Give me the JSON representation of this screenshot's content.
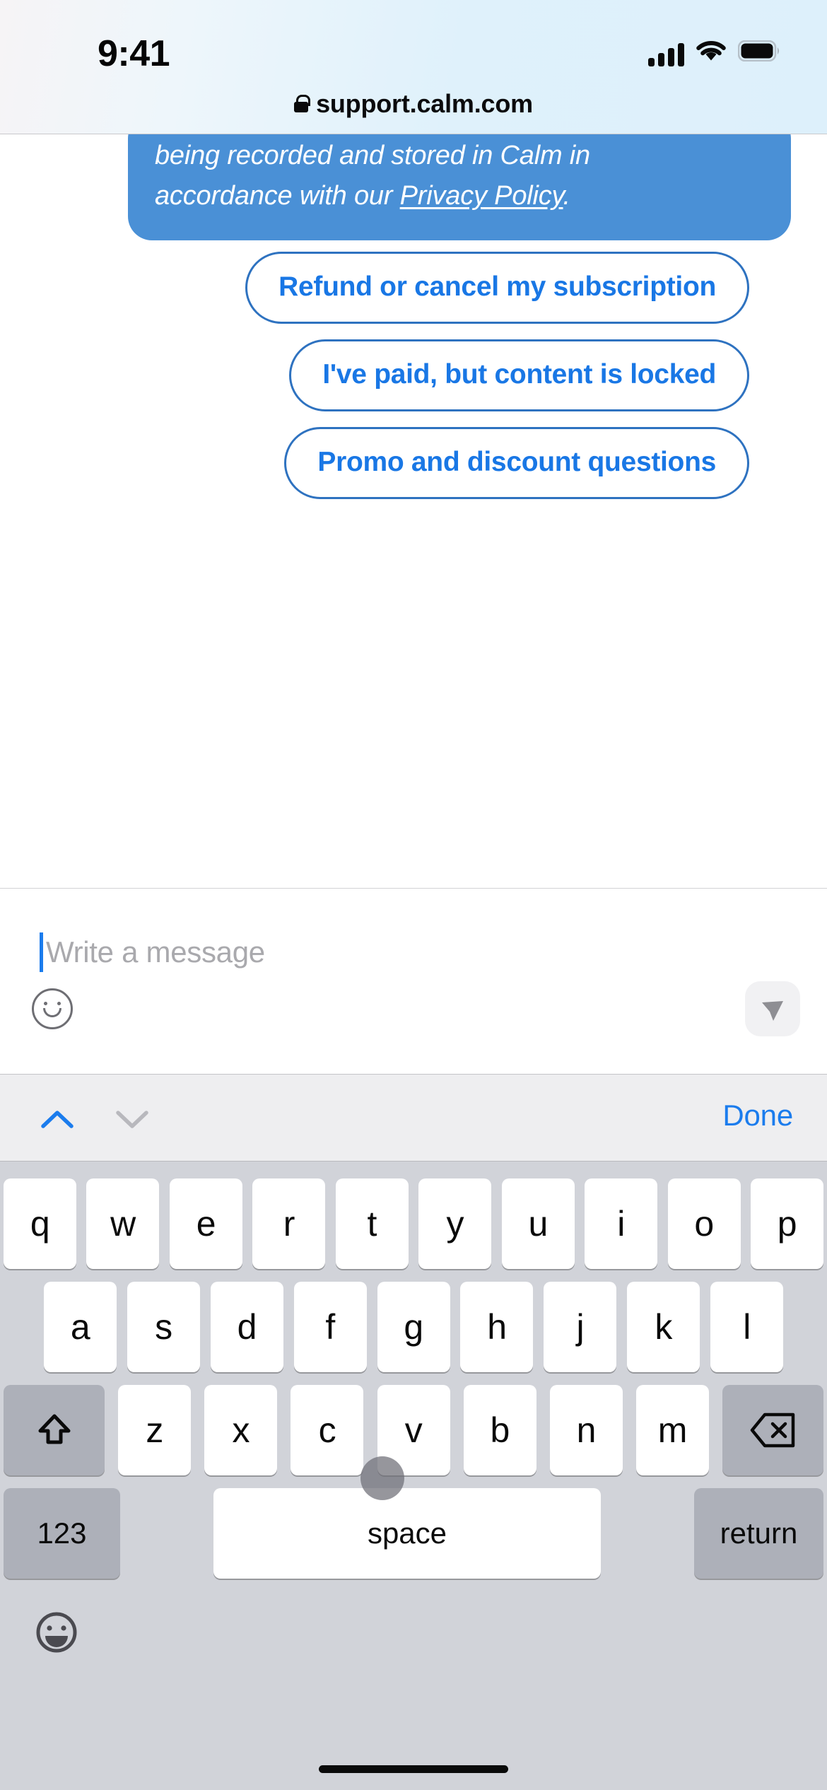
{
  "status_bar": {
    "time": "9:41",
    "signal_icon": "cellular-signal-icon",
    "wifi_icon": "wifi-icon",
    "battery_icon": "battery-icon"
  },
  "browser": {
    "lock_icon": "lock-icon",
    "url": "support.calm.com"
  },
  "chat": {
    "bubble": {
      "line1": "being recorded and stored in Calm in",
      "line2_prefix": "accordance with our ",
      "link_text": "Privacy Policy",
      "line2_suffix": ".",
      "background_color": "#4a90d6",
      "text_color": "#ffffff"
    },
    "quick_replies": [
      {
        "label": "Refund or cancel my subscription"
      },
      {
        "label": "I've paid, but content is locked"
      },
      {
        "label": "Promo and discount questions"
      }
    ],
    "quick_reply_border_color": "#2e72c0",
    "quick_reply_text_color": "#1977e5"
  },
  "composer": {
    "placeholder": "Write a message",
    "value": "",
    "caret_color": "#1b7ced",
    "emoji_icon": "smiley-face-icon",
    "send_icon": "send-paper-plane-icon"
  },
  "keyboard_accessory": {
    "prev_icon": "chevron-up-icon",
    "next_icon": "chevron-down-icon",
    "prev_enabled_color": "#1b7ced",
    "next_disabled_color": "#b8b8bd",
    "done_label": "Done",
    "done_color": "#1b7ced"
  },
  "keyboard": {
    "row1": [
      "q",
      "w",
      "e",
      "r",
      "t",
      "y",
      "u",
      "i",
      "o",
      "p"
    ],
    "row2": [
      "a",
      "s",
      "d",
      "f",
      "g",
      "h",
      "j",
      "k",
      "l"
    ],
    "row3": [
      "z",
      "x",
      "c",
      "v",
      "b",
      "n",
      "m"
    ],
    "shift_icon": "shift-arrow-icon",
    "delete_icon": "backspace-delete-icon",
    "numbers_label": "123",
    "space_label": "space",
    "return_label": "return",
    "globe_icon": "emoji-globe-icon"
  },
  "touch_indicator": {
    "icon": "touch-cursor-dot"
  },
  "home_indicator": {
    "icon": "home-indicator-bar"
  }
}
